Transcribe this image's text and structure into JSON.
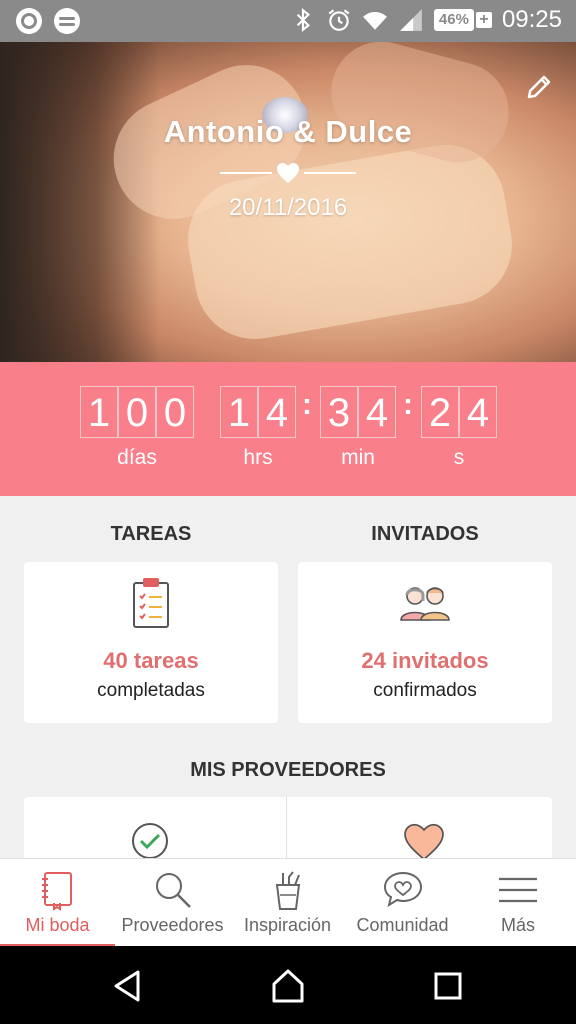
{
  "status_bar": {
    "battery_percent": "46%",
    "time": "09:25"
  },
  "hero": {
    "title": "Antonio & Dulce",
    "date": "20/11/2016"
  },
  "countdown": {
    "days": [
      "1",
      "0",
      "0"
    ],
    "hours": [
      "1",
      "4"
    ],
    "minutes": [
      "3",
      "4"
    ],
    "seconds": [
      "2",
      "4"
    ],
    "labels": {
      "days": "días",
      "hours": "hrs",
      "minutes": "min",
      "seconds": "s"
    },
    "separator": ":"
  },
  "tareas": {
    "section_title": "TAREAS",
    "count": "40 tareas",
    "sub": "completadas"
  },
  "invitados": {
    "section_title": "INVITADOS",
    "count": "24 invitados",
    "sub": "confirmados"
  },
  "proveedores": {
    "section_title": "MIS PROVEEDORES"
  },
  "bottom_nav": {
    "items": [
      {
        "label": "Mi boda",
        "icon": "notebook-icon",
        "active": true
      },
      {
        "label": "Proveedores",
        "icon": "search-icon",
        "active": false
      },
      {
        "label": "Inspiración",
        "icon": "tools-cup-icon",
        "active": false
      },
      {
        "label": "Comunidad",
        "icon": "chat-heart-icon",
        "active": false
      },
      {
        "label": "Más",
        "icon": "menu-icon",
        "active": false
      }
    ]
  },
  "colors": {
    "accent": "#f97f8b",
    "active_nav": "#e05e5e",
    "count_text": "#e07070"
  }
}
